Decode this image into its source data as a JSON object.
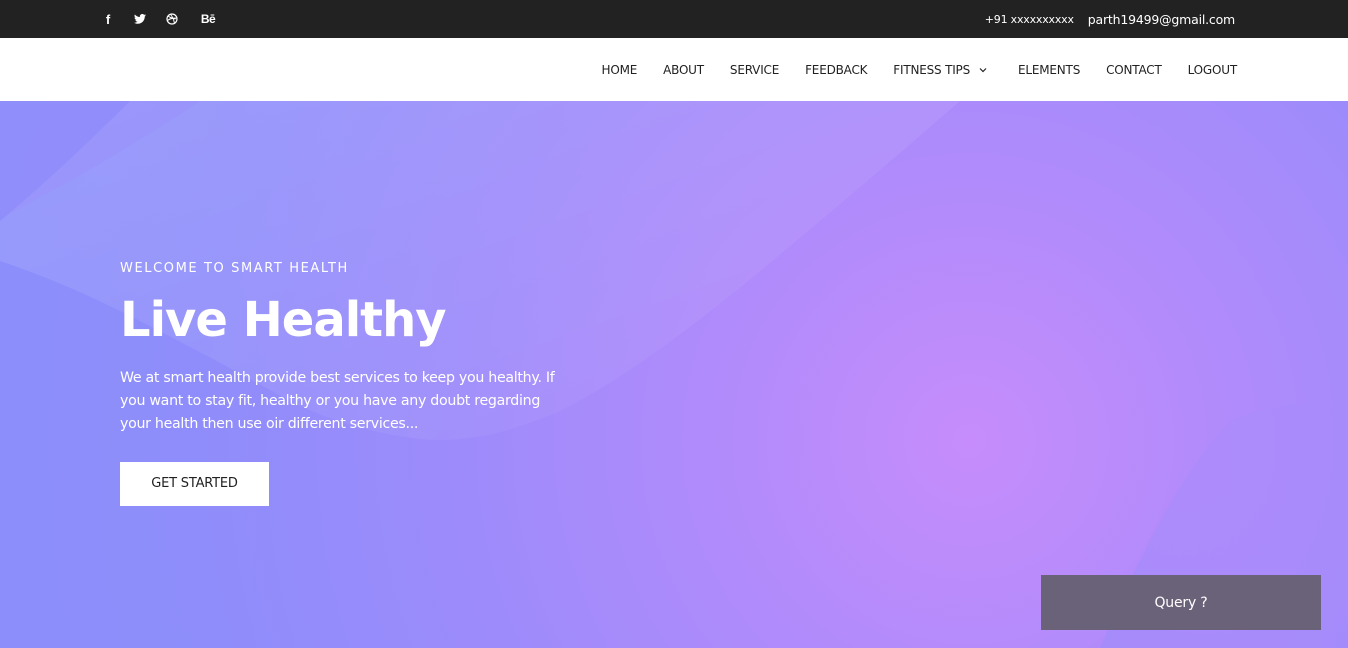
{
  "topbar": {
    "social": [
      {
        "icon": "facebook-icon",
        "glyph": "f"
      },
      {
        "icon": "twitter-icon",
        "glyph": ""
      },
      {
        "icon": "dribbble-icon",
        "glyph": ""
      },
      {
        "icon": "behance-icon",
        "glyph": "Bē"
      }
    ],
    "phone": "+91 xxxxxxxxxx",
    "email": "parth19499@gmail.com"
  },
  "nav": {
    "items": [
      "HOME",
      "ABOUT",
      "SERVICE",
      "FEEDBACK",
      "FITNESS TIPS",
      "ELEMENTS",
      "CONTACT",
      "LOGOUT"
    ]
  },
  "hero": {
    "eyebrow": "WELCOME TO SMART HEALTH",
    "title": "Live Healthy",
    "description": "We at smart health provide best services to keep you healthy. If you want to stay fit, healthy or you have any doubt regarding your health then use oir different services...",
    "cta_label": "GET STARTED"
  },
  "query_button": "Query ?",
  "colors": {
    "topbar_bg": "#222222",
    "hero_gradient_center": "#c68cfb",
    "hero_gradient_edge": "#8b8ffb",
    "query_bg": "#6a6278"
  }
}
